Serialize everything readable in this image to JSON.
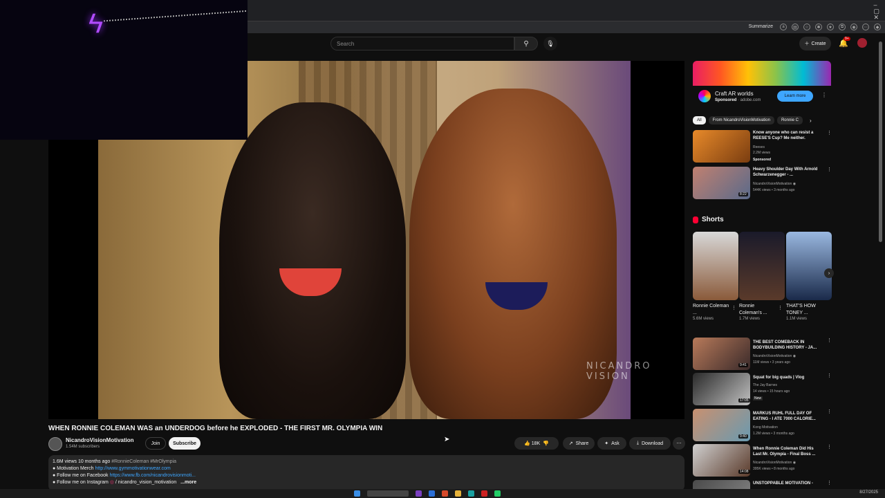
{
  "browser": {
    "summarize_label": "Summarize",
    "window_controls": [
      "–",
      "▢",
      "✕"
    ]
  },
  "header": {
    "search_placeholder": "Search",
    "create_label": "Create",
    "notification_count": "9+"
  },
  "video": {
    "watermark": "NICANDRO VISION",
    "title": "WHEN RONNIE COLEMAN WAS an UNDERDOG before he EXPLODED - THE FIRST MR. OLYMPIA WIN",
    "channel_name": "NicandroVisionMotivation",
    "subscribers": "1.54M subscribers",
    "join_label": "Join",
    "subscribe_label": "Subscribe",
    "likes": "18K",
    "share_label": "Share",
    "ask_label": "Ask",
    "download_label": "Download"
  },
  "description": {
    "stats": "1.6M views  10 months ago",
    "tags": "#RonnieColeman #MrOlympia",
    "line1_label": "● Motivation Merch",
    "line1_link": "http://www.gymmotivationwear.com",
    "line2_label": "● Follow me on Facebook",
    "line2_link": "https://www.fb.com/nicandrovisionmoti...",
    "line3_label": "● Follow me on Instagram",
    "line3_link": "/ nicandro_vision_motivation",
    "more_label": "...more"
  },
  "ad": {
    "title": "Craft AR worlds",
    "sponsored": "Sponsored",
    "domain": "· adobe.com",
    "cta": "Learn more"
  },
  "chips": [
    "All",
    "From NicandroVisionMotivation",
    "Ronnie C"
  ],
  "recommendations_top": [
    {
      "title": "Know anyone who can resist a REESE'S Cup? Me neither.",
      "channel": "Reeses",
      "meta": "2.2M views",
      "badge": "Sponsored",
      "duration": ""
    },
    {
      "title": "Heavy Shoulder Day With Arnold Schwarzenegger - ...",
      "channel": "NicandroVisionMotivation ◉",
      "meta": "544K views • 3 months ago",
      "badge": "",
      "duration": "8:22"
    }
  ],
  "shorts": {
    "heading": "Shorts",
    "items": [
      {
        "title": "Ronnie Coleman ...",
        "views": "5.6M views"
      },
      {
        "title": "Ronnie Coleman's ...",
        "views": "1.7M views"
      },
      {
        "title": "THAT'S HOW TONEY ...",
        "views": "1.1M views"
      }
    ]
  },
  "recommendations_bottom": [
    {
      "title": "THE BEST COMEBACK IN BODYBUILDING HISTORY - JA...",
      "channel": "NicandroVisionMotivation ◉",
      "meta": "11M views • 3 years ago",
      "badge": "",
      "duration": "9:41"
    },
    {
      "title": "Squat for big quads | Vlog",
      "channel": "The Jay Barnes",
      "meta": "14 views • 15 hours ago",
      "badge": "New",
      "duration": "17:05"
    },
    {
      "title": "MARKUS RUHL FULL DAY OF EATING - I ATE 7000 CALORIE...",
      "channel": "Kong Motivation",
      "meta": "1.2M views • 3 months ago",
      "badge": "",
      "duration": "9:40"
    },
    {
      "title": "When Ronnie Coleman Did His Last Mr. Olympia - Final Boss ...",
      "channel": "NicandroVisionMotivation ◉",
      "meta": "395K views • 8 months ago",
      "badge": "",
      "duration": "14:08"
    },
    {
      "title": "UNSTOPPABLE MOTIVATION -",
      "channel": "",
      "meta": "",
      "badge": "",
      "duration": ""
    }
  ],
  "taskbar": {
    "date": "8/27/2025"
  },
  "colors": {
    "background": "#0f0f0f",
    "accent_blue": "#3ea6ff",
    "youtube_red": "#ff0033"
  }
}
